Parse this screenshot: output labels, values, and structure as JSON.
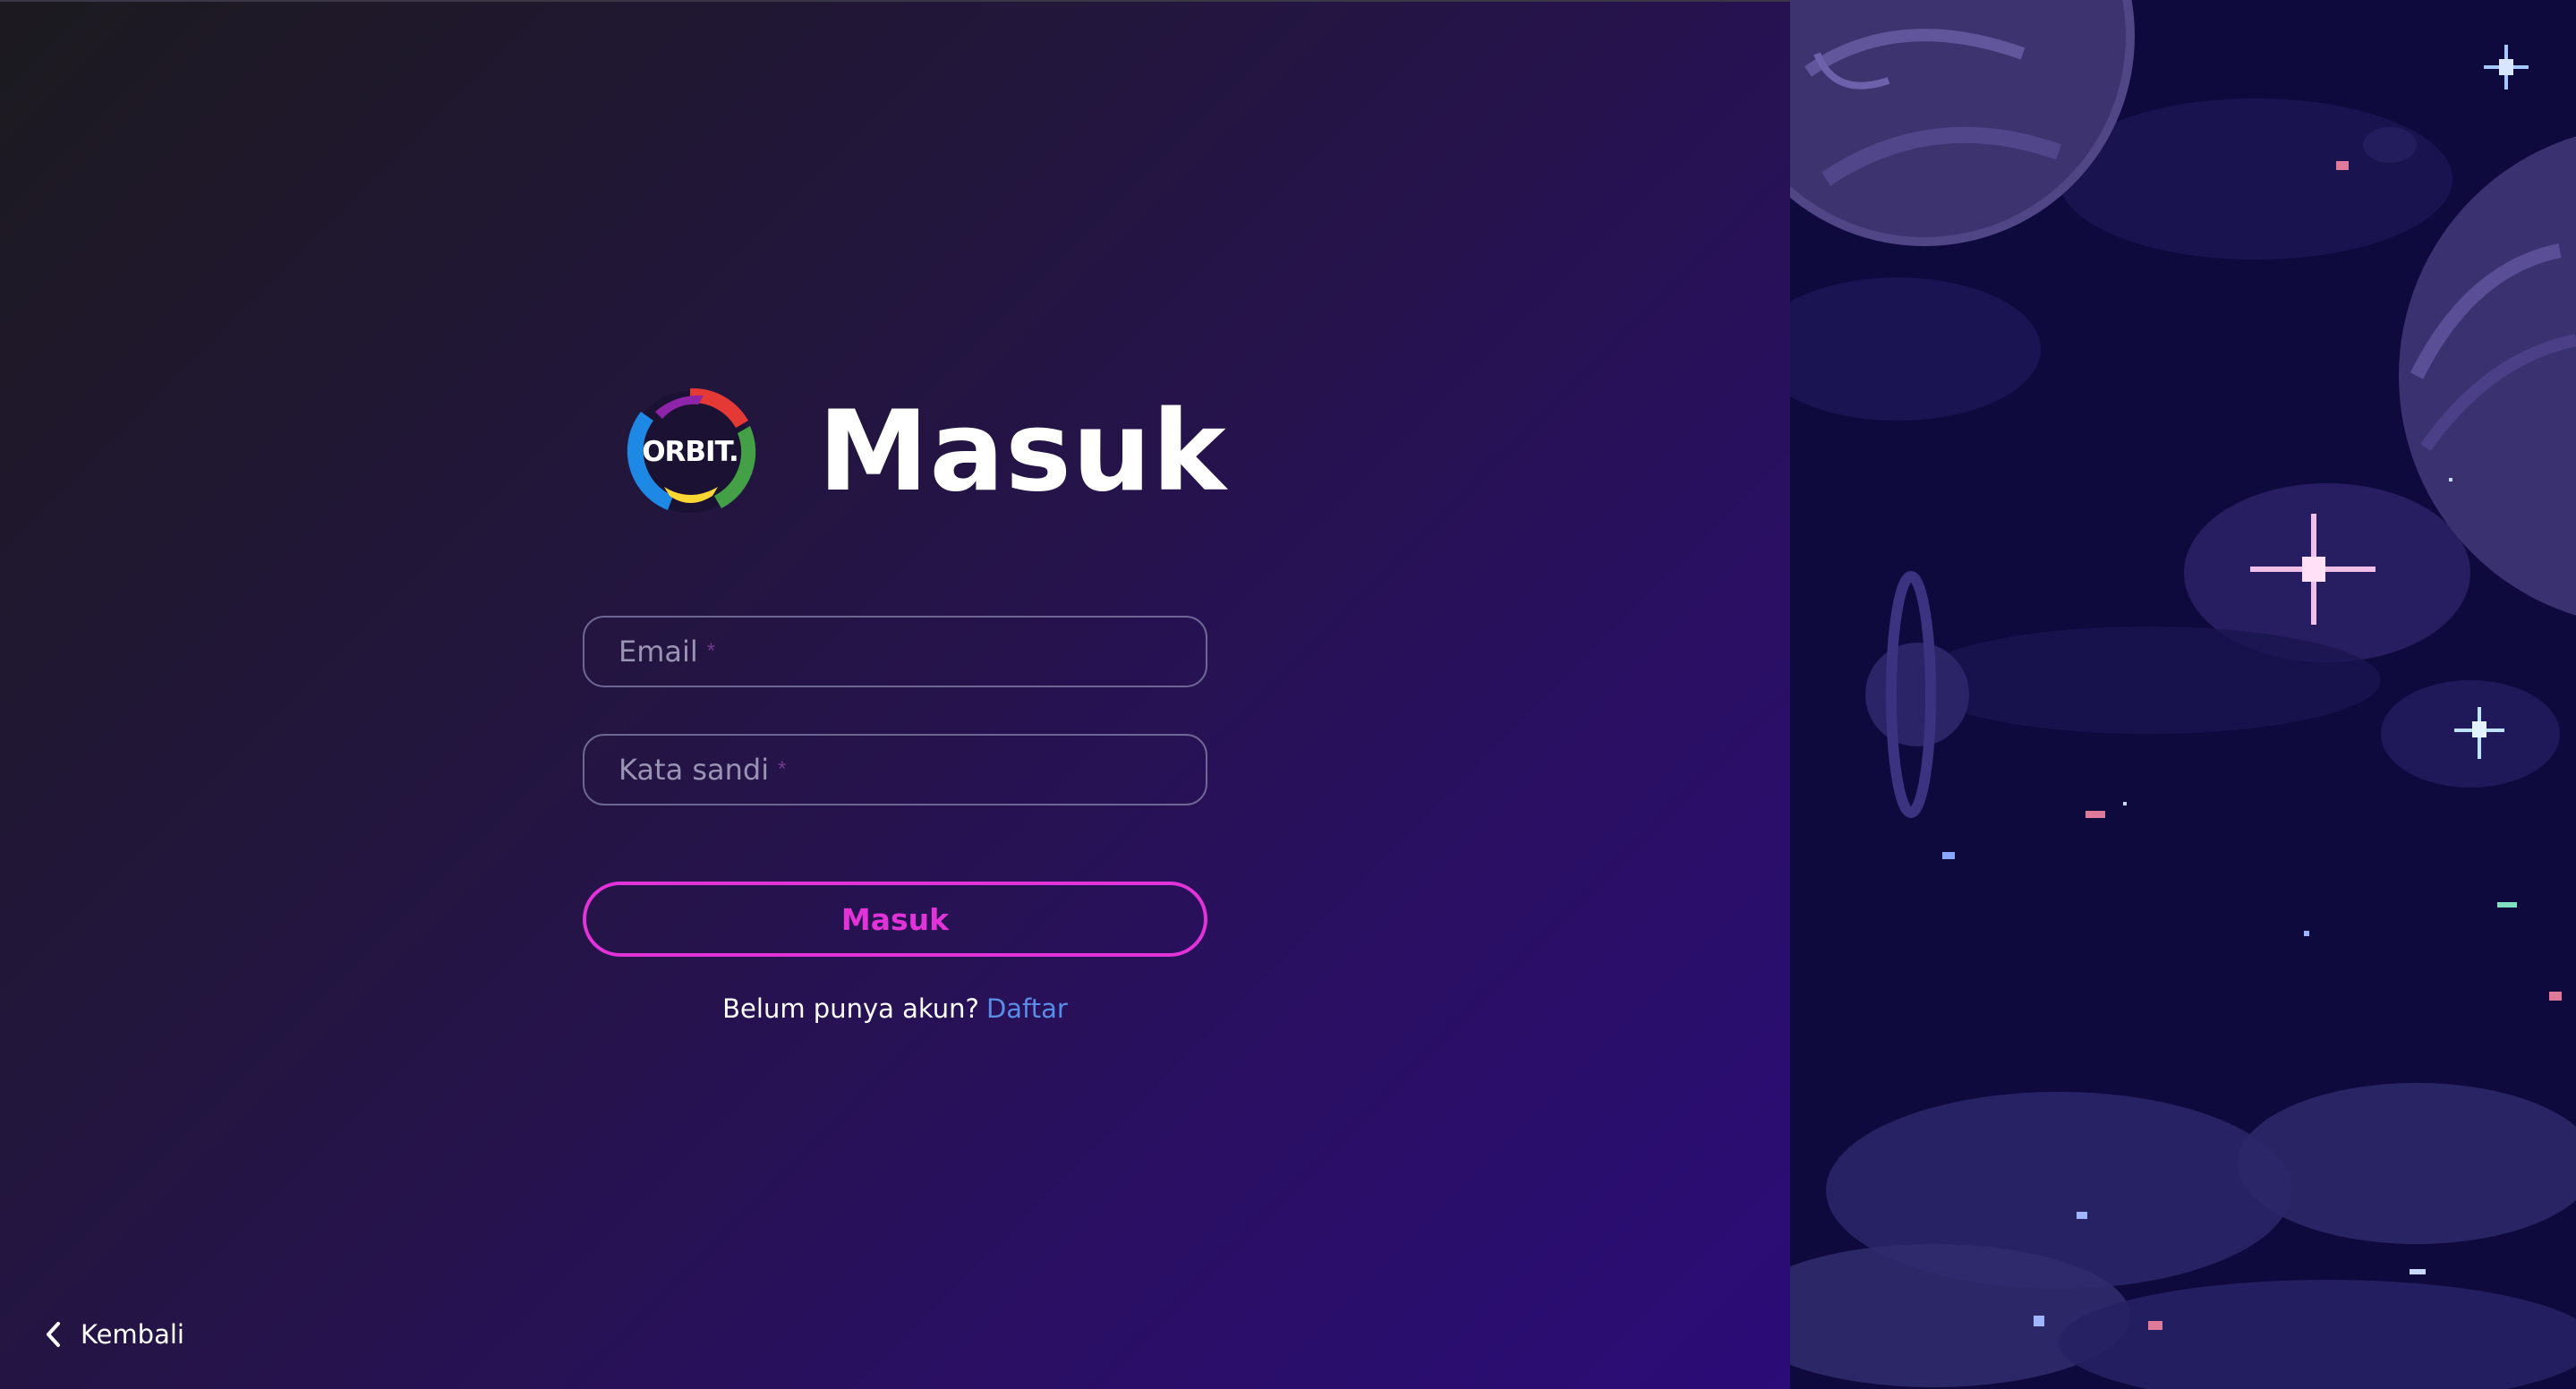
{
  "brand": {
    "logo_text": "ORBIT.",
    "logo_colors": [
      "#e53935",
      "#43a047",
      "#1e88e5",
      "#fdd835",
      "#8e24aa"
    ]
  },
  "page_title": "Masuk",
  "form": {
    "email_label": "Email",
    "email_required_mark": "*",
    "password_label": "Kata sandi",
    "password_required_mark": "*",
    "submit_label": "Masuk"
  },
  "signup": {
    "prompt": "Belum punya akun?",
    "link_label": "Daftar"
  },
  "back": {
    "label": "Kembali",
    "icon": "chevron-left-icon"
  },
  "theme": {
    "accent": "#e233d8",
    "link": "#5a8de6",
    "background": "#231540"
  },
  "illustration": {
    "description_icon": "pixel-space-illustration"
  }
}
